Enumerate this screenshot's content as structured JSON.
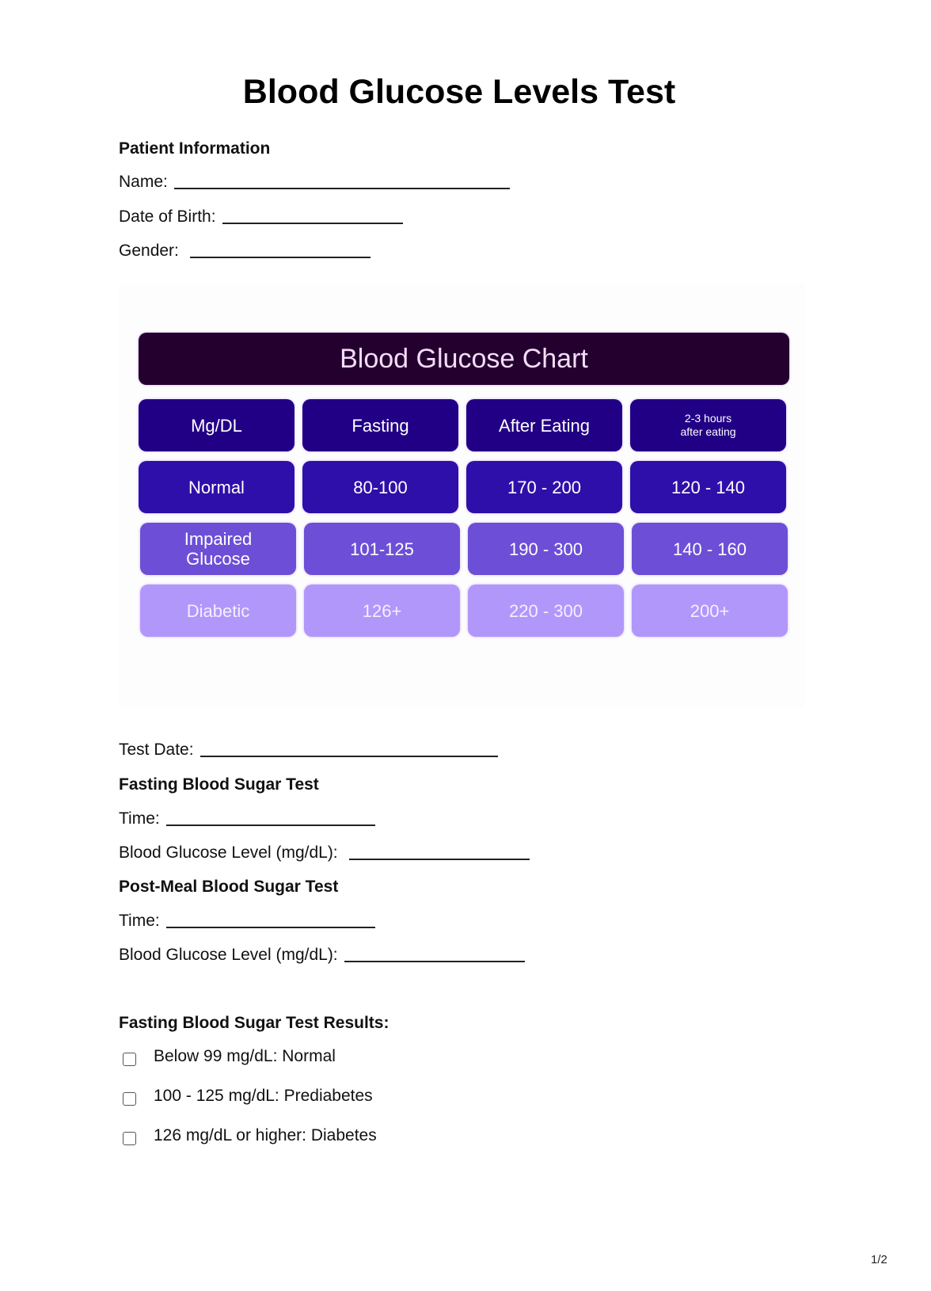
{
  "document": {
    "title": "Blood Glucose Levels Test",
    "page_number": "1/2"
  },
  "patient_info": {
    "heading": "Patient Information",
    "name_label": "Name:",
    "name_value": "",
    "dob_label": "Date of Birth:",
    "dob_value": "",
    "gender_label": "Gender:",
    "gender_value": ""
  },
  "glucose_chart": {
    "title": "Blood Glucose Chart",
    "colors": {
      "title_bg": "#24002f",
      "header_bg": "#220085",
      "normal_bg": "#2f0faa",
      "impaired_bg": "#6c4fd6",
      "diabetic_bg": "#b297fb"
    },
    "headers": [
      "Mg/DL",
      "Fasting",
      "After Eating",
      "2-3 hours\nafter eating"
    ],
    "header_line1": "2-3 hours",
    "header_line2": "after eating",
    "rows": [
      {
        "label": "Normal",
        "fasting": "80-100",
        "after_eating": "170 - 200",
        "two_three_hours": "120 - 140"
      },
      {
        "label": "Impaired",
        "label_line2": "Glucose",
        "fasting": "101-125",
        "after_eating": "190 - 300",
        "two_three_hours": "140 - 160"
      },
      {
        "label": "Diabetic",
        "fasting": "126+",
        "after_eating": "220 - 300",
        "two_three_hours": "200+"
      }
    ]
  },
  "test_date": {
    "label": "Test Date:",
    "value": ""
  },
  "fasting_test": {
    "heading": "Fasting Blood Sugar Test",
    "time_label": "Time:",
    "time_value": "",
    "level_label": "Blood Glucose Level (mg/dL):",
    "level_value": ""
  },
  "post_meal_test": {
    "heading": "Post-Meal Blood Sugar Test",
    "time_label": "Time:",
    "time_value": "",
    "level_label": "Blood Glucose Level (mg/dL):",
    "level_value": ""
  },
  "fasting_results": {
    "heading": "Fasting Blood Sugar Test Results:",
    "options": [
      {
        "label": "Below 99 mg/dL: Normal",
        "checked": false
      },
      {
        "label": "100 - 125 mg/dL: Prediabetes",
        "checked": false
      },
      {
        "label": "126 mg/dL or higher: Diabetes",
        "checked": false
      }
    ]
  }
}
